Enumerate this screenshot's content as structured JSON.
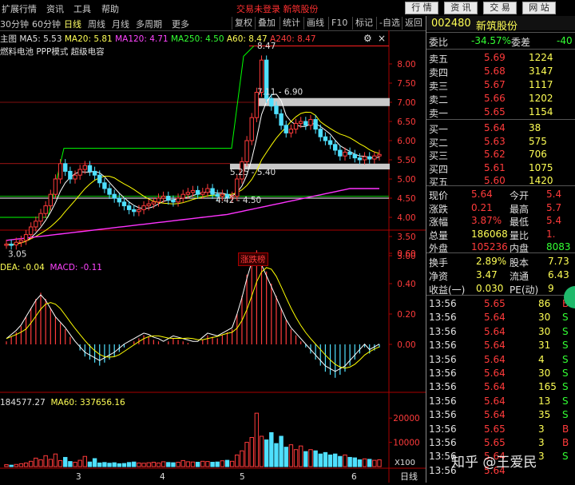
{
  "menubar": {
    "items": [
      "扩展行情",
      "资讯",
      "工具",
      "帮助"
    ],
    "status": "交易未登录  新筑股份",
    "buttons": [
      "行 情",
      "资 讯",
      "交 易",
      "网 站"
    ]
  },
  "periods": [
    "30分钟",
    "60分钟",
    "日线",
    "周线",
    "月线",
    "多周期",
    "更多"
  ],
  "periods_right": [
    "复权",
    "叠加",
    "统计",
    "画线",
    "F10",
    "标记",
    "-自选",
    "返回"
  ],
  "indicator_line": {
    "title": "主图",
    "ma5": "MA5: 5.53",
    "ma20": "MA20: 5.81",
    "ma120": "MA120: 4.71",
    "ma250": "MA250: 4.50",
    "a60": "A60: 8.47",
    "a240": "A240: 8.47"
  },
  "concepts": "燃料电池 PPP模式 超级电容",
  "chart_data": [
    {
      "type": "line",
      "title": "主图",
      "series": [
        {
          "name": "MA5"
        },
        {
          "name": "MA20"
        },
        {
          "name": "MA120"
        },
        {
          "name": "MA250"
        }
      ],
      "x": [
        1,
        2,
        3,
        4,
        5,
        6,
        7,
        8,
        9,
        10,
        11,
        12,
        13,
        14,
        15,
        16,
        17,
        18,
        19,
        20,
        21,
        22,
        23,
        24,
        25,
        26,
        27,
        28,
        29,
        30,
        31,
        32,
        33,
        34,
        35,
        36,
        37,
        38,
        39,
        40,
        41,
        42,
        43,
        44,
        45,
        46,
        47,
        48,
        49,
        50,
        51,
        52,
        53,
        54,
        55,
        56,
        57,
        58,
        59,
        60,
        61,
        62,
        63,
        64,
        65,
        66,
        67,
        68,
        69,
        70,
        71,
        72,
        73,
        74,
        75,
        76,
        77
      ],
      "close": [
        3.3,
        3.28,
        3.35,
        3.4,
        3.55,
        3.75,
        3.9,
        4.1,
        4.3,
        4.6,
        5.0,
        5.4,
        5.2,
        5.0,
        5.1,
        5.25,
        5.35,
        5.2,
        5.1,
        4.9,
        4.75,
        4.6,
        4.5,
        4.4,
        4.3,
        4.2,
        4.15,
        4.2,
        4.3,
        4.35,
        4.4,
        4.5,
        4.55,
        4.45,
        4.4,
        4.5,
        4.6,
        4.65,
        4.7,
        4.6,
        4.65,
        4.75,
        4.6,
        4.55,
        4.6,
        4.5,
        4.55,
        5.0,
        5.45,
        6.0,
        6.6,
        7.26,
        8.1,
        7.1,
        6.9,
        6.7,
        6.4,
        6.2,
        6.3,
        6.45,
        6.5,
        6.4,
        6.55,
        6.3,
        6.1,
        6.0,
        5.9,
        5.75,
        5.6,
        5.7,
        5.64,
        5.55,
        5.5,
        5.58,
        5.52,
        5.6,
        5.64
      ],
      "ylim": [
        3.0,
        8.5
      ],
      "y_ticks": [
        "8.00",
        "7.50",
        "7.00",
        "6.50",
        "6.00",
        "5.50",
        "5.00",
        "4.50",
        "4.00",
        "3.50",
        "3.00"
      ],
      "annotations": [
        "8.47",
        "7.11 - 6.90",
        "5.25 - 5.40",
        "4.42 - 4.50",
        "3.05",
        "涨跌榜"
      ]
    },
    {
      "type": "bar",
      "title": "MACD",
      "series": [
        {
          "name": "DEA",
          "value": -0.04
        },
        {
          "name": "MACD",
          "value": -0.11
        }
      ],
      "ylim": [
        -0.3,
        0.7
      ],
      "y_ticks": [
        "0.60",
        "0.40",
        "0.20",
        "0.00"
      ],
      "values": [
        0.02,
        0.05,
        0.08,
        0.12,
        0.18,
        0.24,
        0.3,
        0.34,
        0.3,
        0.24,
        0.18,
        0.14,
        0.1,
        0.05,
        0.0,
        -0.04,
        -0.08,
        -0.1,
        -0.12,
        -0.14,
        -0.12,
        -0.1,
        -0.08,
        -0.05,
        -0.02,
        0.0,
        0.02,
        0.04,
        0.06,
        0.05,
        0.03,
        0.02,
        0.0,
        0.02,
        0.04,
        0.03,
        0.02,
        0.01,
        0.0,
        0.0,
        0.03,
        0.06,
        0.05,
        0.04,
        0.06,
        0.08,
        0.1,
        0.2,
        0.32,
        0.46,
        0.58,
        0.62,
        0.56,
        0.48,
        0.4,
        0.32,
        0.24,
        0.16,
        0.1,
        0.06,
        0.02,
        -0.02,
        -0.06,
        -0.1,
        -0.14,
        -0.18,
        -0.2,
        -0.22,
        -0.2,
        -0.18,
        -0.14,
        -0.1,
        -0.06,
        -0.02,
        -0.06,
        -0.04,
        -0.02
      ]
    },
    {
      "type": "bar",
      "title": "VOL",
      "series": [
        {
          "name": "MA5",
          "value": 184577.27
        },
        {
          "name": "MA60",
          "value": 337656.16
        }
      ],
      "y_ticks": [
        "20000",
        "10000",
        "X100"
      ],
      "values": [
        800,
        600,
        900,
        1200,
        1500,
        2200,
        3500,
        2800,
        4500,
        3000,
        5200,
        2500,
        3800,
        2100,
        1800,
        2600,
        4200,
        1900,
        3300,
        1500,
        1700,
        1400,
        1600,
        1200,
        1300,
        1700,
        1900,
        1500,
        1400,
        1600,
        1800,
        1500,
        2000,
        1700,
        1600,
        1800,
        2500,
        2000,
        1900,
        1800,
        2200,
        2100,
        1800,
        1900,
        2400,
        2600,
        2200,
        4800,
        6500,
        10000,
        12000,
        22000,
        12500,
        11000,
        14000,
        9500,
        12500,
        8000,
        9000,
        7000,
        8500,
        6200,
        7000,
        6500,
        5200,
        5800,
        4800,
        5200,
        4200,
        4800,
        3800,
        3600,
        2800,
        3200,
        3000,
        2600,
        2800
      ]
    }
  ],
  "x_axis_labels": [
    "3",
    "4",
    "5",
    "6"
  ],
  "bottom_tabs": [
    "日线"
  ],
  "panel": {
    "code": "002480",
    "name": "新筑股份",
    "weibi_label": "委比",
    "weibi_value": "-34.57%",
    "weicha_label": "委差",
    "weicha_value": "-40",
    "asks": [
      {
        "label": "卖五",
        "price": "5.69",
        "vol": "1224"
      },
      {
        "label": "卖四",
        "price": "5.68",
        "vol": "3147"
      },
      {
        "label": "卖三",
        "price": "5.67",
        "vol": "1117"
      },
      {
        "label": "卖二",
        "price": "5.66",
        "vol": "1202"
      },
      {
        "label": "卖一",
        "price": "5.65",
        "vol": "1154"
      }
    ],
    "bids": [
      {
        "label": "买一",
        "price": "5.64",
        "vol": "38"
      },
      {
        "label": "买二",
        "price": "5.63",
        "vol": "575"
      },
      {
        "label": "买三",
        "price": "5.62",
        "vol": "706"
      },
      {
        "label": "买四",
        "price": "5.61",
        "vol": "1075"
      },
      {
        "label": "买五",
        "price": "5.60",
        "vol": "1420"
      }
    ],
    "quote": [
      {
        "l1": "现价",
        "v1": "5.64",
        "l2": "今开",
        "v2": "5.4"
      },
      {
        "l1": "涨跌",
        "v1": "0.21",
        "l2": "最高",
        "v2": "5.7"
      },
      {
        "l1": "涨幅",
        "v1": "3.87%",
        "l2": "最低",
        "v2": "5.4"
      },
      {
        "l1": "总量",
        "v1": "186068",
        "l2": "量比",
        "v2": "1."
      },
      {
        "l1": "外盘",
        "v1": "105236",
        "l2": "内盘",
        "v2": "8083"
      }
    ],
    "stats": [
      {
        "l1": "换手",
        "v1": "2.89%",
        "l2": "股本",
        "v2": "7.73"
      },
      {
        "l1": "净资",
        "v1": "3.47",
        "l2": "流通",
        "v2": "6.43"
      },
      {
        "l1": "收益(一)",
        "v1": "0.030",
        "l2": "PE(动)",
        "v2": "9"
      }
    ],
    "ticks": [
      {
        "t": "13:56",
        "p": "5.65",
        "v": "86",
        "d": "B"
      },
      {
        "t": "13:56",
        "p": "5.64",
        "v": "30",
        "d": "S"
      },
      {
        "t": "13:56",
        "p": "5.64",
        "v": "30",
        "d": "S"
      },
      {
        "t": "13:56",
        "p": "5.64",
        "v": "31",
        "d": "S"
      },
      {
        "t": "13:56",
        "p": "5.64",
        "v": "4",
        "d": "S"
      },
      {
        "t": "13:56",
        "p": "5.64",
        "v": "30",
        "d": "S"
      },
      {
        "t": "13:56",
        "p": "5.64",
        "v": "165",
        "d": "S"
      },
      {
        "t": "13:56",
        "p": "5.64",
        "v": "13",
        "d": "S"
      },
      {
        "t": "13:56",
        "p": "5.64",
        "v": "35",
        "d": "S"
      },
      {
        "t": "13:56",
        "p": "5.65",
        "v": "3",
        "d": "B"
      },
      {
        "t": "13:56",
        "p": "5.65",
        "v": "3",
        "d": "B"
      },
      {
        "t": "13:56",
        "p": "5.64",
        "v": "3",
        "d": "S"
      },
      {
        "t": "13:56",
        "p": "5.64",
        "v": "",
        "d": ""
      }
    ]
  },
  "watermark": "知乎 @王爱民",
  "colors": {
    "up": "#ff3b3b",
    "down": "#4fe0ff",
    "ma5": "#ffffff",
    "ma20": "#ffff00",
    "ma120": "#00ff00",
    "ma250": "#ff33ff"
  }
}
